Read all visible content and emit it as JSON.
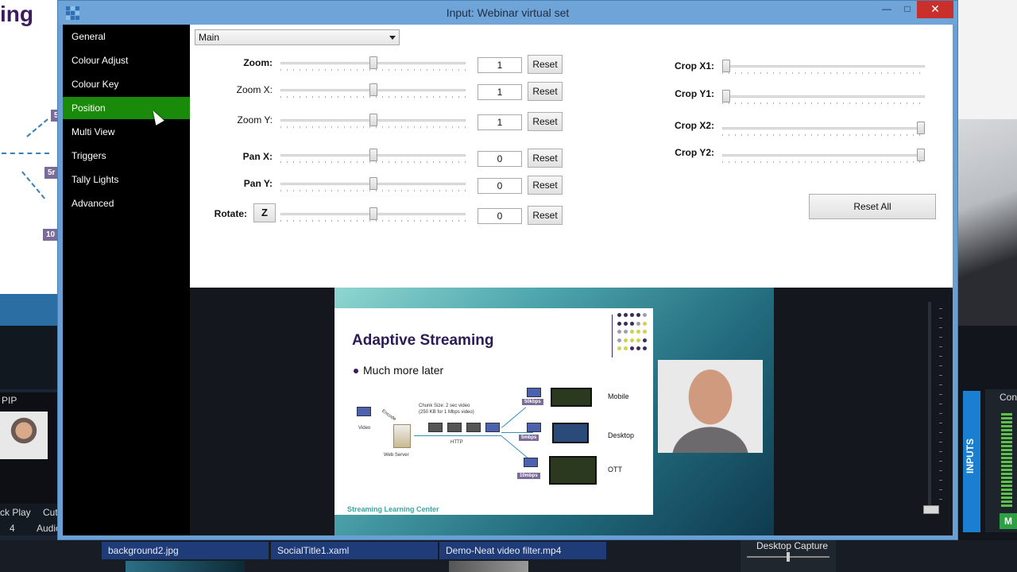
{
  "window": {
    "title": "Input: Webinar virtual set"
  },
  "sidebar": {
    "items": [
      {
        "label": "General"
      },
      {
        "label": "Colour Adjust"
      },
      {
        "label": "Colour Key"
      },
      {
        "label": "Position"
      },
      {
        "label": "Multi View"
      },
      {
        "label": "Triggers"
      },
      {
        "label": "Tally Lights"
      },
      {
        "label": "Advanced"
      }
    ],
    "active_index": 3
  },
  "panel": {
    "layer_select": "Main",
    "controls": [
      {
        "label": "Zoom:",
        "value": "1",
        "reset": "Reset",
        "thumb": 0.5
      },
      {
        "label": "Zoom X:",
        "value": "1",
        "reset": "Reset",
        "thumb": 0.5
      },
      {
        "label": "Zoom Y:",
        "value": "1",
        "reset": "Reset",
        "thumb": 0.5
      },
      {
        "label": "Pan X:",
        "value": "0",
        "reset": "Reset",
        "thumb": 0.5
      },
      {
        "label": "Pan Y:",
        "value": "0",
        "reset": "Reset",
        "thumb": 0.5
      },
      {
        "label": "Rotate:",
        "value": "0",
        "reset": "Reset",
        "thumb": 0.5
      }
    ],
    "rotate_z_label": "Z",
    "crop": [
      {
        "label": "Crop X1:",
        "thumb": 0.0
      },
      {
        "label": "Crop Y1:",
        "thumb": 0.0
      },
      {
        "label": "Crop X2:",
        "thumb": 1.0
      },
      {
        "label": "Crop Y2:",
        "thumb": 1.0
      }
    ],
    "reset_all": "Reset All"
  },
  "preview": {
    "slide_title": "Adaptive Streaming",
    "slide_bullet": "Much more later",
    "footer": "Streaming Learning Center",
    "diagram": {
      "video": "Video",
      "encode": "Encode",
      "chunk": "Chunk Size: 2 sec video",
      "chunk2": "(250 KB for 1 Mbps video)",
      "server": "Web Server",
      "http": "HTTP",
      "rate1": "50kbps",
      "rate2": "5mbps",
      "rate3": "10mbps",
      "dest1": "Mobile",
      "dest2": "Desktop",
      "dest3": "OTT"
    }
  },
  "background": {
    "partial_title": "ing",
    "nodes": [
      "5",
      "5r",
      "10"
    ],
    "pip_label": "PIP",
    "bottom_labels": [
      "ck Play",
      "Cut",
      "4",
      "Audio"
    ],
    "inputs_tab": "INPUTS",
    "conv_label": "Conv",
    "m_label": "M",
    "files": [
      "background2.jpg",
      "SocialTitle1.xaml",
      "Demo-Neat video filter.mp4"
    ],
    "desktop_capture": "Desktop Capture"
  },
  "colors": {
    "active_nav": "#1a8a0a",
    "titlebar": "#6fa4d8",
    "close": "#c9302c"
  }
}
